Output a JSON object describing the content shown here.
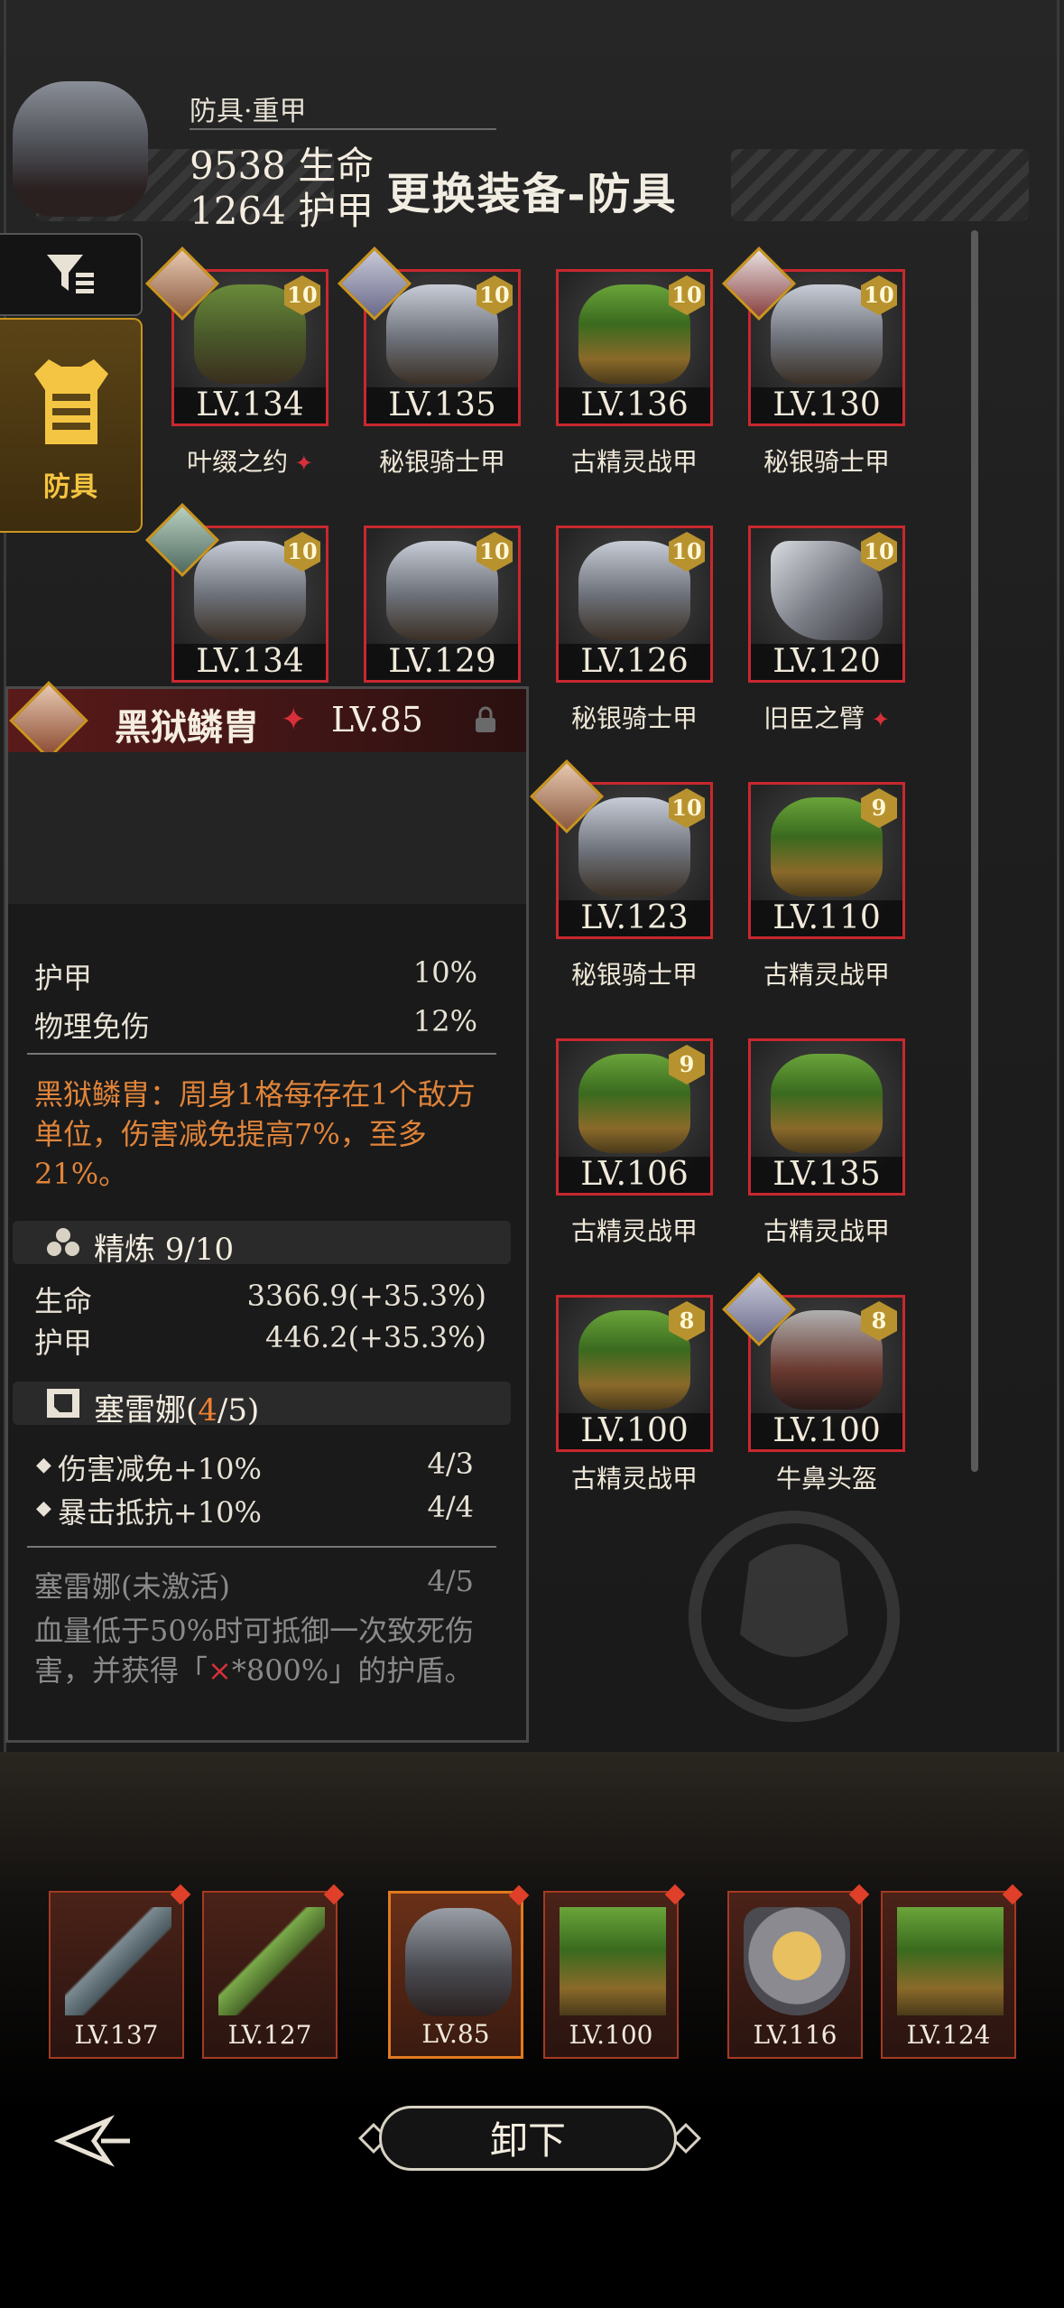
{
  "title": "更换装备-防具",
  "side_tabs": {
    "armor_label": "防具"
  },
  "items": [
    {
      "lv": "LV.134",
      "count": "10",
      "name": "叶缀之约",
      "gem": true,
      "art": "leaf",
      "avatar": "av1"
    },
    {
      "lv": "LV.135",
      "count": "10",
      "name": "秘银骑士甲",
      "art": "knight",
      "avatar": "av2"
    },
    {
      "lv": "LV.136",
      "count": "10",
      "name": "古精灵战甲",
      "art": "elf"
    },
    {
      "lv": "LV.130",
      "count": "10",
      "name": "秘银骑士甲",
      "art": "knight",
      "avatar": "av3"
    },
    {
      "lv": "LV.134",
      "count": "10",
      "name": "",
      "art": "knight",
      "avatar": "av4"
    },
    {
      "lv": "LV.129",
      "count": "10",
      "name": "",
      "art": "knight"
    },
    {
      "lv": "LV.126",
      "count": "10",
      "name": "秘银骑士甲",
      "art": "knight"
    },
    {
      "lv": "LV.120",
      "count": "10",
      "name": "旧臣之臂",
      "gem": true,
      "art": "gauntlet"
    },
    {
      "lv": "LV.123",
      "count": "10",
      "name": "秘银骑士甲",
      "art": "knight",
      "avatar": "av1"
    },
    {
      "lv": "LV.110",
      "count": "9",
      "name": "古精灵战甲",
      "art": "elf"
    },
    {
      "lv": "LV.106",
      "count": "9",
      "name": "古精灵战甲",
      "art": "elf"
    },
    {
      "lv": "LV.135",
      "count": "",
      "name": "古精灵战甲",
      "art": "elf"
    },
    {
      "lv": "LV.100",
      "count": "8",
      "name": "古精灵战甲",
      "art": "elf"
    },
    {
      "lv": "LV.100",
      "count": "8",
      "name": "牛鼻头盔",
      "art": "helm",
      "avatar": "av2"
    }
  ],
  "detail": {
    "name": "黑狱鳞胄",
    "lv": "LV.85",
    "type": "防具·重甲",
    "stat1": "9538 生命",
    "stat2": "1264 护甲",
    "rows": [
      {
        "label": "护甲",
        "value": "10%"
      },
      {
        "label": "物理免伤",
        "value": "12%"
      }
    ],
    "effect": "黑狱鳞胄：周身1格每存在1个敌方单位，伤害减免提高7%，至多21%。",
    "refine": {
      "label": "精炼 9/10",
      "rows": [
        {
          "label": "生命",
          "value": "3366.9(+35.3%)"
        },
        {
          "label": "护甲",
          "value": "446.2(+35.3%)"
        }
      ]
    },
    "set": {
      "name": "塞雷娜(",
      "count_hl": "4",
      "count_rest": "/5)",
      "rows": [
        {
          "label": "伤害减免+10%",
          "value": "4/3"
        },
        {
          "label": "暴击抵抗+10%",
          "value": "4/4"
        }
      ]
    },
    "inactive": {
      "label": "塞雷娜(未激活)",
      "value": "4/5",
      "desc_a": "血量低于50%时可抵御一次致死伤害，并获得「",
      "desc_x": "×",
      "desc_b": "*800%」的护盾。"
    }
  },
  "equipped": [
    {
      "lv": "LV.137",
      "art": "sword"
    },
    {
      "lv": "LV.127",
      "art": "greensword"
    },
    {
      "lv": "LV.85",
      "art": "darkarmor",
      "selected": true
    },
    {
      "lv": "LV.100",
      "art": "elf"
    },
    {
      "lv": "LV.116",
      "art": "shield"
    },
    {
      "lv": "LV.124",
      "art": "elf"
    }
  ],
  "unequip_label": "卸下"
}
